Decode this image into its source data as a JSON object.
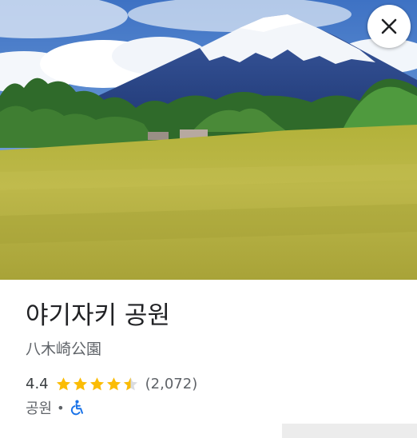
{
  "place": {
    "name": "야기자키 공원",
    "native_name": "八木崎公園",
    "rating": "4.4",
    "rating_value": 4.4,
    "review_count": "(2,072)",
    "category": "공원",
    "separator": "•"
  },
  "icons": {
    "close": "close-icon",
    "star": "star-icon",
    "accessibility": "wheelchair-accessible-icon"
  },
  "colors": {
    "star": "#fbbc04",
    "star_empty": "#dadce0",
    "accessibility": "#1a73e8",
    "title": "#202124",
    "secondary_text": "#5f6368"
  }
}
